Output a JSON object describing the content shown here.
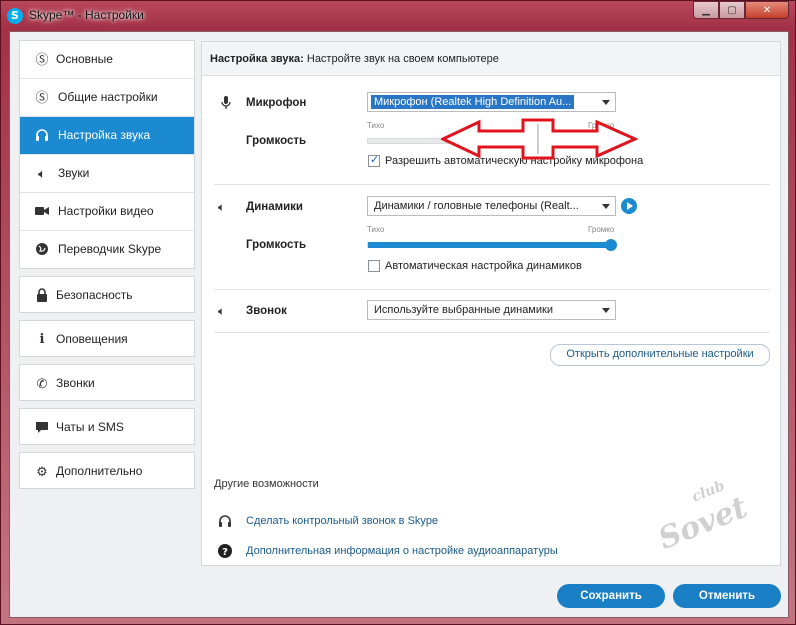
{
  "window": {
    "title": "Skype™ - Настройки"
  },
  "sidebar": {
    "group1": [
      {
        "label": "Основные",
        "icon": "skype-logo-icon"
      },
      {
        "label": "Общие настройки",
        "icon": "skype-logo-icon"
      },
      {
        "label": "Настройка звука",
        "icon": "headset-icon"
      },
      {
        "label": "Звуки",
        "icon": "speaker-icon"
      },
      {
        "label": "Настройки видео",
        "icon": "video-camera-icon"
      },
      {
        "label": "Переводчик Skype",
        "icon": "globe-icon"
      }
    ],
    "others": [
      {
        "label": "Безопасность",
        "icon": "lock-icon"
      },
      {
        "label": "Оповещения",
        "icon": "info-icon"
      },
      {
        "label": "Звонки",
        "icon": "phone-icon"
      },
      {
        "label": "Чаты и SMS",
        "icon": "chat-icon"
      },
      {
        "label": "Дополнительно",
        "icon": "gear-icon"
      }
    ]
  },
  "panel": {
    "header_bold": "Настройка звука:",
    "header_rest": " Настройте звук на своем компьютере",
    "mic": {
      "label": "Микрофон",
      "device": "Микрофон (Realtek High Definition Au...",
      "volume_label": "Громкость",
      "quiet": "Тихо",
      "loud": "Громко",
      "level": 0.0,
      "auto_label": "Разрешить автоматическую настройку микрофона",
      "auto_checked": true
    },
    "speakers": {
      "label": "Динамики",
      "device": "Динамики / головные телефоны (Realt...",
      "volume_label": "Громкость",
      "quiet": "Тихо",
      "loud": "Громко",
      "level": 1.0,
      "auto_label": "Автоматическая настройка динамиков",
      "auto_checked": false
    },
    "ring": {
      "label": "Звонок",
      "device": "Используйте выбранные динамики"
    },
    "advanced_button": "Открыть дополнительные настройки",
    "other_title": "Другие возможности",
    "test_call_link": "Сделать контрольный звонок в Skype",
    "audio_help_link": "Дополнительная информация о настройке аудиоаппаратуры"
  },
  "buttons": {
    "save": "Сохранить",
    "cancel": "Отменить"
  },
  "watermark": {
    "line1": "club",
    "line2": "Sovet"
  },
  "colors": {
    "accent": "#1c8ad1",
    "annotation": "#e0141e"
  }
}
